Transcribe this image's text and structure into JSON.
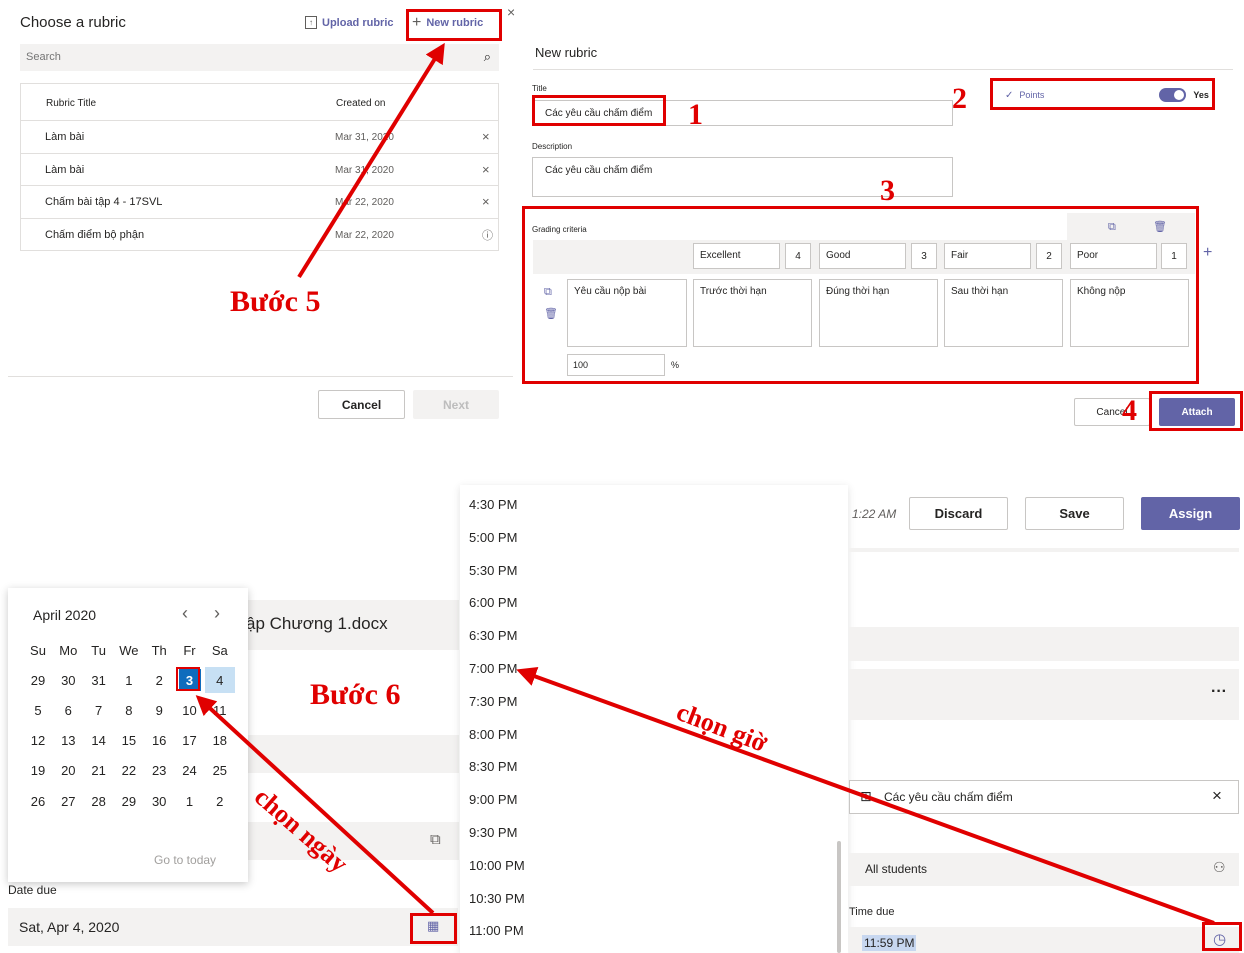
{
  "choose_rubric": {
    "title": "Choose a rubric",
    "upload_label": "Upload rubric",
    "new_label": "New rubric",
    "search_placeholder": "Search",
    "col_title": "Rubric Title",
    "col_created": "Created on",
    "rows": [
      {
        "title": "Làm bài",
        "date": "Mar 31, 2020"
      },
      {
        "title": "Làm bài",
        "date": "Mar 31, 2020"
      },
      {
        "title": "Chấm bài tập 4 - 17SVL",
        "date": "Mar 22, 2020"
      },
      {
        "title": "Chấm điểm bộ phận",
        "date": "Mar 22, 2020"
      }
    ],
    "cancel_label": "Cancel",
    "next_label": "Next"
  },
  "new_rubric": {
    "heading": "New rubric",
    "title_label": "Title",
    "title_value": "Các yêu cầu chấm điểm",
    "description_label": "Description",
    "description_value": "Các yêu cầu chấm điểm",
    "points_label": "Points",
    "points_toggle_label": "Yes",
    "grading_label": "Grading criteria",
    "levels": [
      {
        "name": "Excellent",
        "points": "4"
      },
      {
        "name": "Good",
        "points": "3"
      },
      {
        "name": "Fair",
        "points": "2"
      },
      {
        "name": "Poor",
        "points": "1"
      }
    ],
    "criterion": "Yêu cầu nộp bài",
    "descriptors": [
      "Trước thời hạn",
      "Đúng thời hạn",
      "Sau thời hạn",
      "Không nộp"
    ],
    "weight": "100",
    "weight_unit": "%",
    "cancel_label": "Cancel",
    "attach_label": "Attach"
  },
  "annotations": {
    "n1": "1",
    "n2": "2",
    "n3": "3",
    "n4": "4",
    "step5": "Bước 5",
    "step6": "Bước 6",
    "pick_day": "chọn ngày",
    "pick_time": "chọn giờ"
  },
  "calendar": {
    "month": "April 2020",
    "weekdays": [
      "Su",
      "Mo",
      "Tu",
      "We",
      "Th",
      "Fr",
      "Sa"
    ],
    "weeks": [
      [
        "29",
        "30",
        "31",
        "1",
        "2",
        "3",
        "4"
      ],
      [
        "5",
        "6",
        "7",
        "8",
        "9",
        "10",
        "11"
      ],
      [
        "12",
        "13",
        "14",
        "15",
        "16",
        "17",
        "18"
      ],
      [
        "19",
        "20",
        "21",
        "22",
        "23",
        "24",
        "25"
      ],
      [
        "26",
        "27",
        "28",
        "29",
        "30",
        "1",
        "2"
      ]
    ],
    "go_today": "Go to today",
    "file_name": "ập Chương 1.docx"
  },
  "date_due": {
    "label": "Date due",
    "value": "Sat, Apr 4, 2020"
  },
  "times": [
    "4:30 PM",
    "5:00 PM",
    "5:30 PM",
    "6:00 PM",
    "6:30 PM",
    "7:00 PM",
    "7:30 PM",
    "8:00 PM",
    "8:30 PM",
    "9:00 PM",
    "9:30 PM",
    "10:00 PM",
    "10:30 PM",
    "11:00 PM"
  ],
  "assignment": {
    "saved_time": "1:22 AM",
    "discard_label": "Discard",
    "save_label": "Save",
    "assign_label": "Assign",
    "rubric_chip": "Các yêu cầu chấm điểm",
    "students": "All students",
    "time_due_label": "Time due",
    "time_due_value": "11:59 PM"
  },
  "colors": {
    "accent": "#6264a7",
    "annotation": "#e00000",
    "selected_day": "#0f6cbd"
  }
}
